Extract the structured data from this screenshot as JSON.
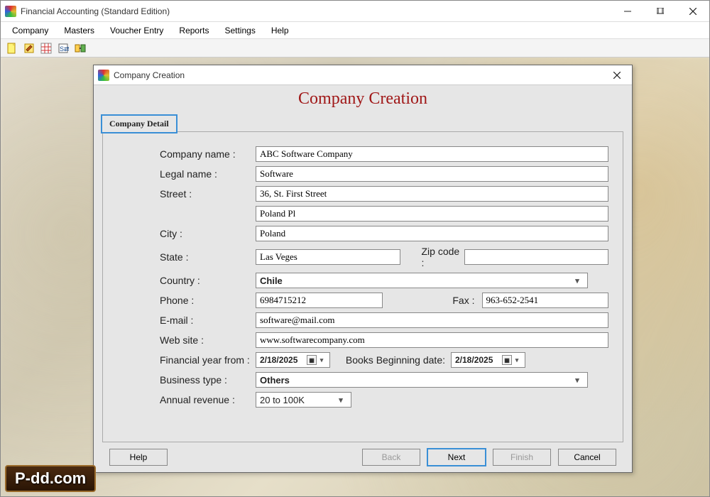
{
  "window": {
    "title": "Financial Accounting (Standard Edition)"
  },
  "menubar": {
    "items": [
      "Company",
      "Masters",
      "Voucher Entry",
      "Reports",
      "Settings",
      "Help"
    ]
  },
  "toolbar": {
    "icons": [
      "new-file-icon",
      "edit-icon",
      "grid-icon",
      "crossref-icon",
      "link-icon"
    ]
  },
  "dialog": {
    "title": "Company Creation",
    "heading": "Company Creation",
    "tab_label": "Company Detail",
    "labels": {
      "company_name": "Company name :",
      "legal_name": "Legal name :",
      "street": "Street :",
      "city": "City :",
      "state": "State :",
      "zip": "Zip code :",
      "country": "Country :",
      "phone": "Phone :",
      "fax": "Fax :",
      "email": "E-mail :",
      "website": "Web site :",
      "fin_year_from": "Financial year from :",
      "books_begin": "Books Beginning date:",
      "business_type": "Business type :",
      "annual_revenue": "Annual revenue :"
    },
    "values": {
      "company_name": "ABC Software Company",
      "legal_name": "Software",
      "street1": "36, St. First Street",
      "street2": "Poland Pl",
      "city": "Poland",
      "state": "Las Veges",
      "zip": "",
      "country": "Chile",
      "phone": "6984715212",
      "fax": "963-652-2541",
      "email": "software@mail.com",
      "website": "www.softwarecompany.com",
      "fin_year_from": "2/18/2025",
      "books_begin": "2/18/2025",
      "business_type": "Others",
      "annual_revenue": "20 to 100K"
    },
    "buttons": {
      "help": "Help",
      "back": "Back",
      "next": "Next",
      "finish": "Finish",
      "cancel": "Cancel"
    }
  },
  "watermark": "P-dd.com"
}
